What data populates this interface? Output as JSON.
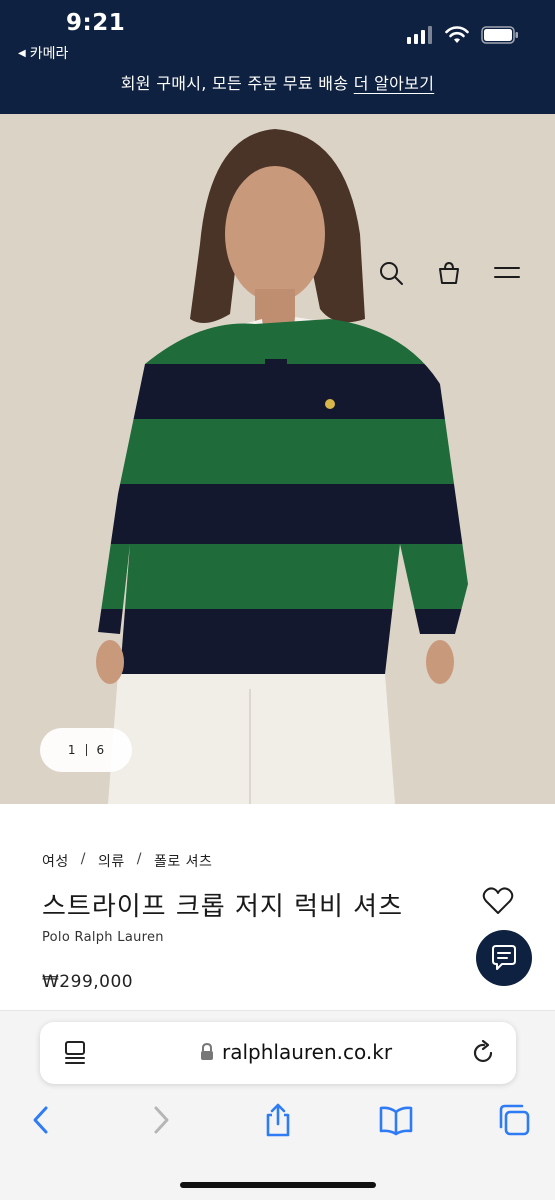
{
  "status_bar": {
    "time": "9:21",
    "back_app": "카메라",
    "icons": [
      "cellular-signal-icon",
      "wifi-icon",
      "battery-icon"
    ]
  },
  "promo_banner": {
    "text": "회원 구매시, 모든 주문 무료 배송",
    "link": "더 알아보기"
  },
  "header_icons": [
    "search-icon",
    "shopping-bag-icon",
    "menu-icon"
  ],
  "gallery": {
    "current": "1",
    "total": "6"
  },
  "product": {
    "breadcrumb": [
      "여성",
      "의류",
      "폴로 셔츠"
    ],
    "title": "스트라이프 크롭 저지 럭비 셔츠",
    "brand": "Polo Ralph Lauren",
    "price": "₩299,000"
  },
  "safari": {
    "url": "ralphlauren.co.kr",
    "toolbar": [
      "back-icon",
      "forward-icon",
      "share-icon",
      "bookmarks-icon",
      "tabs-icon"
    ]
  },
  "colors": {
    "navy": "#0f2140",
    "green": "#1f6b3a",
    "safari_blue": "#2f7bf5"
  }
}
